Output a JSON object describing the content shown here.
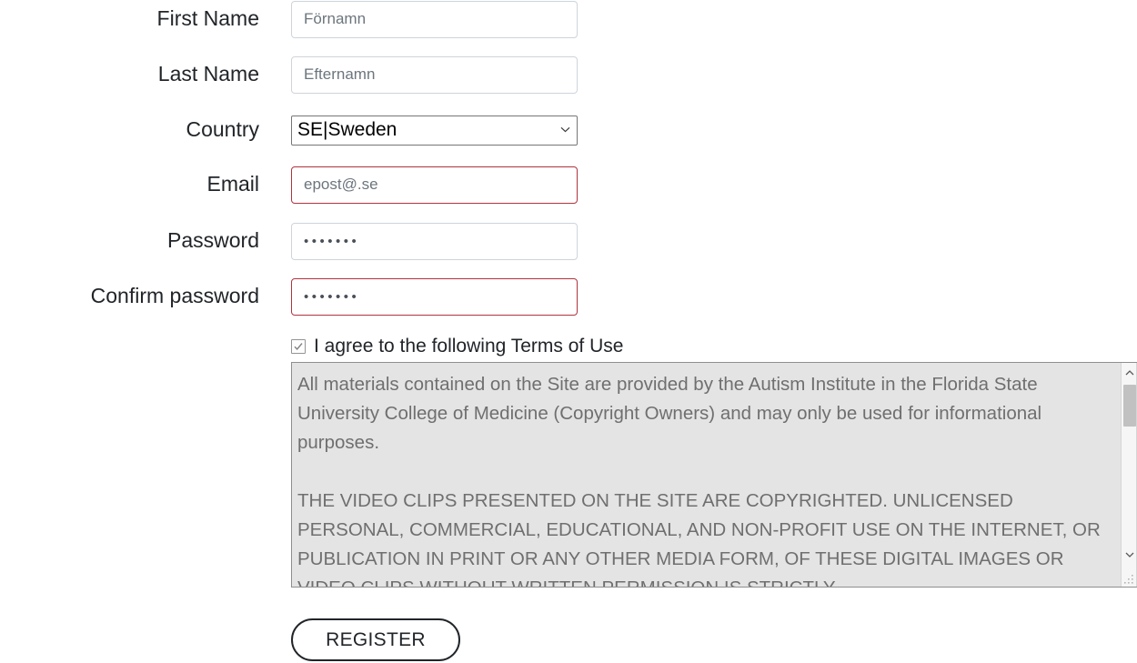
{
  "form": {
    "fields": [
      {
        "name": "first-name",
        "label": "First Name",
        "value": "Förnamn",
        "type": "text",
        "invalid": false
      },
      {
        "name": "last-name",
        "label": "Last Name",
        "value": "Efternamn",
        "type": "text",
        "invalid": false
      },
      {
        "name": "country",
        "label": "Country",
        "value": "SE|Sweden",
        "type": "select",
        "invalid": false
      },
      {
        "name": "email",
        "label": "Email",
        "value": "epost@.se",
        "type": "text",
        "invalid": true
      },
      {
        "name": "password",
        "label": "Password",
        "value": "•••••••",
        "type": "password",
        "invalid": false
      },
      {
        "name": "confirm-password",
        "label": "Confirm password",
        "value": "•••••••",
        "type": "password",
        "invalid": true
      }
    ],
    "terms": {
      "checkbox_checked": true,
      "checkbox_label": "I agree to the following Terms of Use",
      "text": "All materials contained on the Site are provided by the Autism Institute in the Florida State University College of Medicine (Copyright Owners) and may only be used for informational purposes.\n\nTHE VIDEO CLIPS PRESENTED ON THE SITE ARE COPYRIGHTED. UNLICENSED PERSONAL, COMMERCIAL, EDUCATIONAL, AND NON-PROFIT USE ON THE INTERNET, OR PUBLICATION IN PRINT OR ANY OTHER MEDIA FORM, OF THESE DIGITAL IMAGES OR VIDEO CLIPS WITHOUT WRITTEN PERMISSION IS STRICTLY"
    },
    "submit_label": "REGISTER"
  },
  "colors": {
    "invalid_border": "#b0333f",
    "normal_border": "#ced4da",
    "label_text": "#212529",
    "placeholder_text": "#6c757d",
    "terms_background": "#e4e4e4",
    "terms_text": "#6f6f6f"
  },
  "icons": {
    "chevron_down": "chevron-down-icon",
    "check": "check-icon",
    "scroll_up": "scroll-up-arrow-icon",
    "scroll_down": "scroll-down-arrow-icon",
    "resize": "resize-grip-icon"
  }
}
